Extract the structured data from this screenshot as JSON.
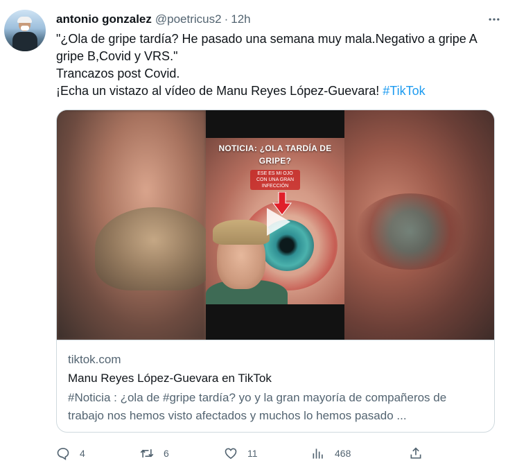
{
  "author": {
    "name": "antonio gonzalez",
    "handle": "@poetricus2",
    "separator": "·",
    "time": "12h"
  },
  "tweet": {
    "line1": "\"¿Ola de gripe tardía? He pasado una semana muy mala.Negativo a gripe A gripe B,Covid y VRS.\"",
    "line2": "Trancazos post Covid.",
    "line3": "¡Echa un vistazo al vídeo de Manu Reyes López-Guevara! ",
    "hashtag": "#TikTok"
  },
  "card": {
    "video_caption": "NOTICIA: ¿OLA TARDÍA DE GRIPE?",
    "video_subcaption": "ESE ES MI OJO CON UNA GRAN INFECCIÓN",
    "domain": "tiktok.com",
    "title": "Manu Reyes López-Guevara en TikTok",
    "description": "#Noticia : ¿ola de #gripe tardía? yo y la gran mayoría de compañeros de trabajo nos hemos visto afectados y muchos lo hemos pasado ..."
  },
  "actions": {
    "replies": "4",
    "retweets": "6",
    "likes": "11",
    "views": "468"
  },
  "colors": {
    "accent": "#1d9bf0",
    "text": "#0f1419",
    "secondary": "#536471",
    "border": "#cfd9de"
  }
}
